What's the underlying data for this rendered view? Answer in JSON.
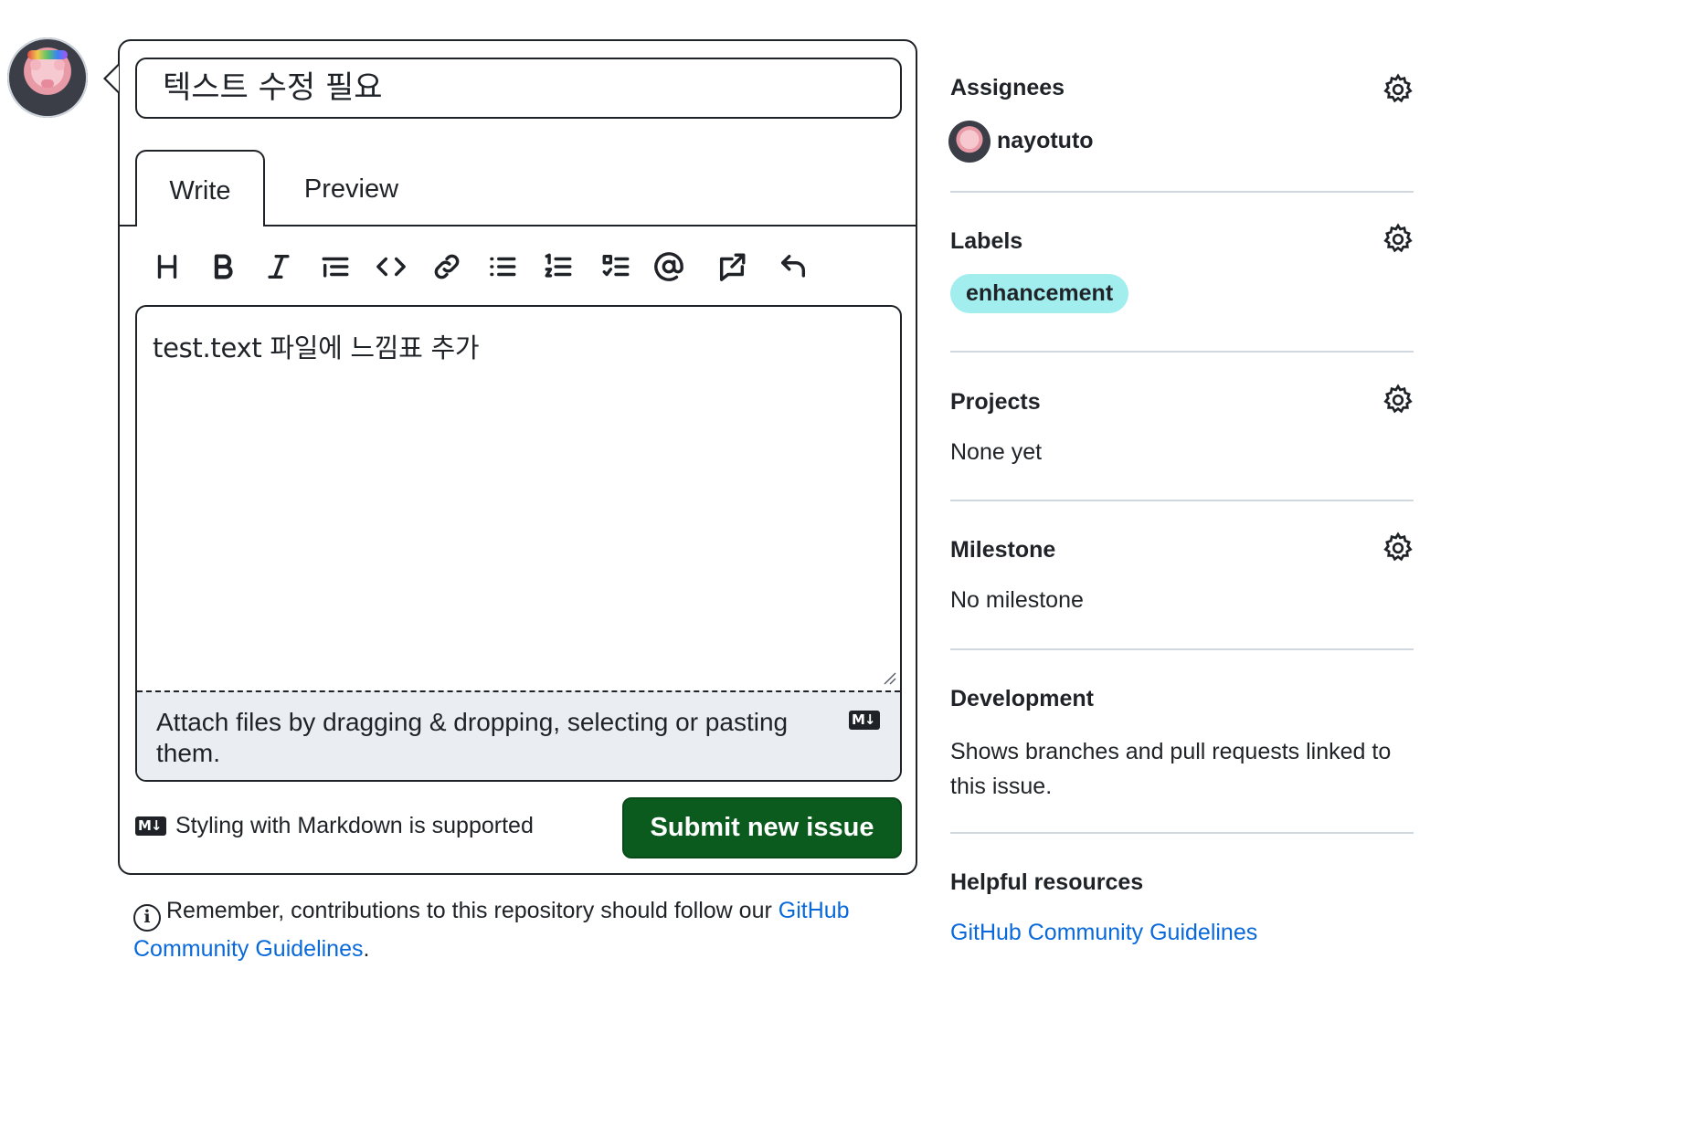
{
  "issue": {
    "title_value": "텍스트 수정 필요",
    "tabs": [
      {
        "label": "Write"
      },
      {
        "label": "Preview"
      }
    ],
    "toolbar_icons": [
      "heading-icon",
      "bold-icon",
      "italic-icon",
      "quote-icon",
      "code-icon",
      "link-icon",
      "unordered-list-icon",
      "ordered-list-icon",
      "task-list-icon",
      "mention-icon",
      "reference-icon",
      "undo-icon"
    ],
    "body_value": "test.text 파일에 느낌표 추가",
    "attach_text": "Attach files by dragging & dropping, selecting or pasting them.",
    "markdown_badge": "M↓",
    "markdown_note": "Styling with Markdown is supported",
    "submit_label": "Submit new issue",
    "reminder_prefix": "Remember, contributions to this repository should follow our ",
    "reminder_link": "GitHub Community Guidelines",
    "reminder_suffix": "."
  },
  "sidebar": {
    "assignees": {
      "heading": "Assignees",
      "user": "nayotuto"
    },
    "labels": {
      "heading": "Labels",
      "label": "enhancement",
      "label_color": "#a2eeef"
    },
    "projects": {
      "heading": "Projects",
      "value": "None yet"
    },
    "milestone": {
      "heading": "Milestone",
      "value": "No milestone"
    },
    "development": {
      "heading": "Development",
      "value": "Shows branches and pull requests linked to this issue."
    },
    "resources": {
      "heading": "Helpful resources",
      "link": "GitHub Community Guidelines"
    }
  },
  "colors": {
    "accent_link": "#0969da",
    "submit_bg": "#0b5b1e",
    "border": "#1f2328"
  }
}
